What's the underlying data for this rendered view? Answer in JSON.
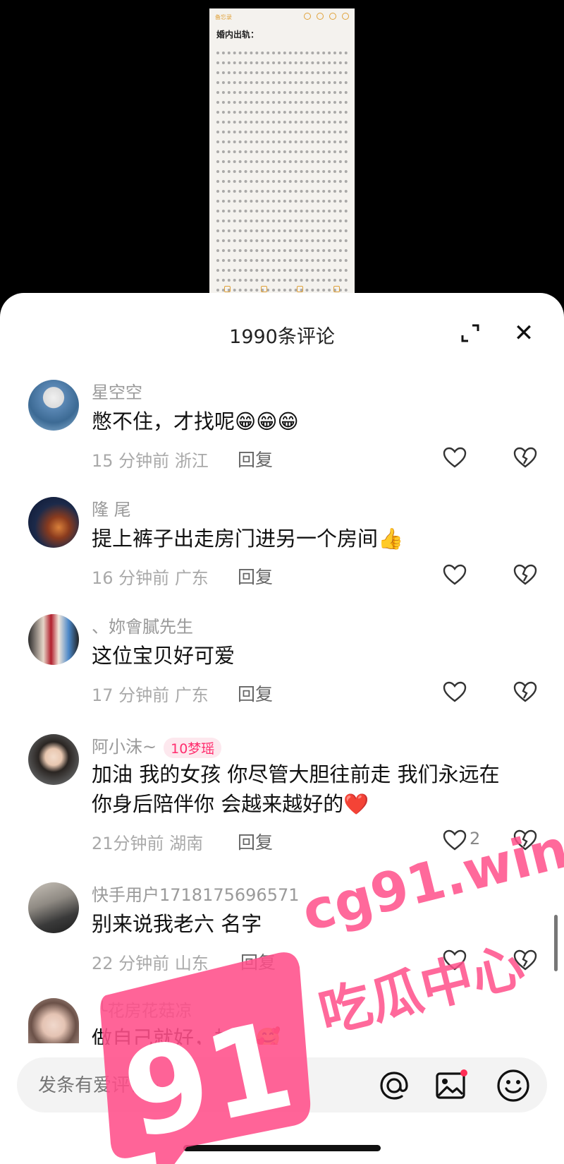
{
  "note": {
    "back_label": "备忘录",
    "title": "婚内出轨："
  },
  "header": {
    "comment_count": "1990条评论"
  },
  "comments": [
    {
      "user": "星空空",
      "badge": "",
      "text_lines": [
        "憋不住，才找呢😁😁😁"
      ],
      "time": "15 分钟前",
      "region": "浙江",
      "reply": "回复",
      "likes": ""
    },
    {
      "user": "隆 尾",
      "badge": "",
      "text_lines": [
        "提上裤子出走房门进另一个房间👍"
      ],
      "time": "16 分钟前",
      "region": "广东",
      "reply": "回复",
      "likes": ""
    },
    {
      "user": "、妳會膩先生",
      "badge": "",
      "text_lines": [
        "这位宝贝好可爱"
      ],
      "time": "17 分钟前",
      "region": "广东",
      "reply": "回复",
      "likes": ""
    },
    {
      "user": "阿小沫~",
      "badge": "10梦瑶",
      "text_lines": [
        "加油 我的女孩 你尽管大胆往前走 我们永远在",
        "你身后陪伴你 会越来越好的❤️"
      ],
      "time": "21分钟前",
      "region": "湖南",
      "reply": "回复",
      "likes": "2"
    },
    {
      "user": "快手用户1718175696571",
      "badge": "",
      "text_lines": [
        "别来说我老六 名字"
      ],
      "time": "22 分钟前",
      "region": "山东",
      "reply": "回复",
      "likes": ""
    },
    {
      "user": "╰花房花菇凉",
      "badge": "",
      "text_lines": [
        "做自己就好，加油🥰"
      ],
      "time": "",
      "region": "",
      "reply": "",
      "likes": ""
    }
  ],
  "input": {
    "placeholder": "发条有爱评论~"
  },
  "watermark": {
    "logo": "91",
    "line1": "cg91.win",
    "line2": "吃瓜中心"
  },
  "colors": {
    "accent": "#ff2d6e",
    "watermark": "#ff4f8a",
    "note_accent": "#e0a23a"
  }
}
